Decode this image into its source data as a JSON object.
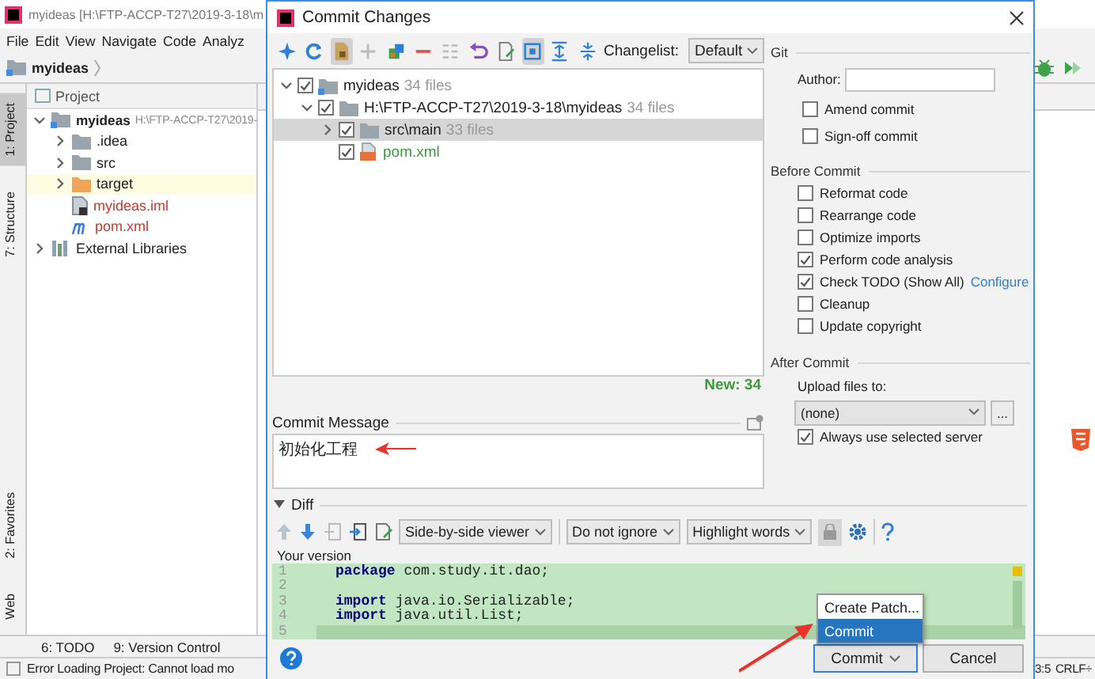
{
  "ide": {
    "title": "myideas [H:\\FTP-ACCP-T27\\2019-3-18\\m",
    "menu": [
      "File",
      "Edit",
      "View",
      "Navigate",
      "Code",
      "Analyz"
    ],
    "breadcrumb": "myideas",
    "tool_tabs_top": [
      {
        "label": "1: Project",
        "selected": true
      },
      {
        "label": "7: Structure",
        "selected": false
      }
    ],
    "tool_tabs_bottom": [
      {
        "label": "2: Favorites",
        "selected": false
      },
      {
        "label": "Web",
        "selected": false
      }
    ],
    "project_panel": {
      "title": "Project",
      "tree": [
        {
          "label": "myideas",
          "path": "H:\\FTP-ACCP-T27\\2019-",
          "kind": "module",
          "expanded": true,
          "children": [
            {
              "label": ".idea",
              "kind": "folder",
              "expanded": false
            },
            {
              "label": "src",
              "kind": "folder",
              "expanded": false
            },
            {
              "label": "target",
              "kind": "excluded_folder",
              "expanded": false
            },
            {
              "label": "myideas.iml",
              "kind": "iml_file"
            },
            {
              "label": "pom.xml",
              "kind": "maven_file"
            }
          ]
        },
        {
          "label": "External Libraries",
          "kind": "library",
          "expanded": false
        }
      ]
    },
    "bottom_tabs": [
      "6: TODO",
      "9: Version Control"
    ],
    "status_bar": {
      "message": "Error Loading Project: Cannot load mo",
      "position": "3:5",
      "line_separator": "CRLF÷"
    }
  },
  "dialog": {
    "title": "Commit Changes",
    "toolbar": [
      {
        "pressed": false
      },
      {
        "pressed": false
      },
      {
        "pressed": true
      },
      {
        "pressed": false
      },
      {
        "pressed": false
      },
      {
        "pressed": false
      },
      {
        "pressed": false
      },
      {
        "pressed": false
      },
      {
        "pressed": false
      },
      {
        "pressed": true
      },
      {
        "pressed": false
      },
      {
        "pressed": false
      }
    ],
    "changelist": {
      "label": "Changelist:",
      "value": "Default"
    },
    "changes_tree": [
      {
        "label": "myideas",
        "count": "34 files",
        "kind": "module",
        "checked": true,
        "expanded": true,
        "selected": false,
        "children": [
          {
            "label": "H:\\FTP-ACCP-T27\\2019-3-18\\myideas",
            "count": "34 files",
            "kind": "folder",
            "checked": true,
            "expanded": true,
            "selected": false,
            "children": [
              {
                "label": "src\\main",
                "count": "33 files",
                "kind": "folder",
                "checked": true,
                "expanded": false,
                "selected": true
              },
              {
                "label": "pom.xml",
                "kind": "file",
                "checked": true,
                "selected": false
              }
            ]
          }
        ]
      }
    ],
    "summary": "New: 34",
    "commit_message": {
      "label": "Commit Message",
      "value": "初始化工程"
    },
    "vcs": {
      "title": "Git",
      "author_label": "Author:",
      "options": [
        {
          "label": "Amend commit",
          "checked": false
        },
        {
          "label": "Sign-off commit",
          "checked": false
        }
      ]
    },
    "before_commit": {
      "title": "Before Commit",
      "options": [
        {
          "label": "Reformat code",
          "checked": false
        },
        {
          "label": "Rearrange code",
          "checked": false
        },
        {
          "label": "Optimize imports",
          "checked": false
        },
        {
          "label": "Perform code analysis",
          "checked": true
        },
        {
          "label": "Check TODO (Show All)",
          "checked": true,
          "link": "Configure"
        },
        {
          "label": "Cleanup",
          "checked": false
        },
        {
          "label": "Update copyright",
          "checked": false
        }
      ]
    },
    "after_commit": {
      "title": "After Commit",
      "upload_label": "Upload files to:",
      "server": "(none)",
      "browse_button": "...",
      "options": [
        {
          "label": "Always use selected server",
          "checked": true
        }
      ]
    },
    "diff": {
      "label": "Diff",
      "expanded": true,
      "viewer": "Side-by-side viewer",
      "ignore": "Do not ignore",
      "highlight": "Highlight words",
      "side_label": "Your version",
      "lines": [
        {
          "number": "1",
          "code": "**package** com.study.it.dao;",
          "current": false
        },
        {
          "number": "2",
          "current": false
        },
        {
          "number": "3",
          "code": "**import** java.io.Serializable;",
          "current": false
        },
        {
          "number": "4",
          "code": "**import** java.util.List;",
          "current": false
        },
        {
          "number": "5",
          "current": true
        }
      ]
    },
    "popup_menu": [
      {
        "label": "Create Patch...",
        "selected": false
      },
      {
        "label": "Commit",
        "selected": true
      }
    ],
    "buttons": [
      {
        "label": "Commit",
        "kind": "split_default"
      },
      {
        "label": "Cancel",
        "kind": "normal"
      }
    ]
  }
}
